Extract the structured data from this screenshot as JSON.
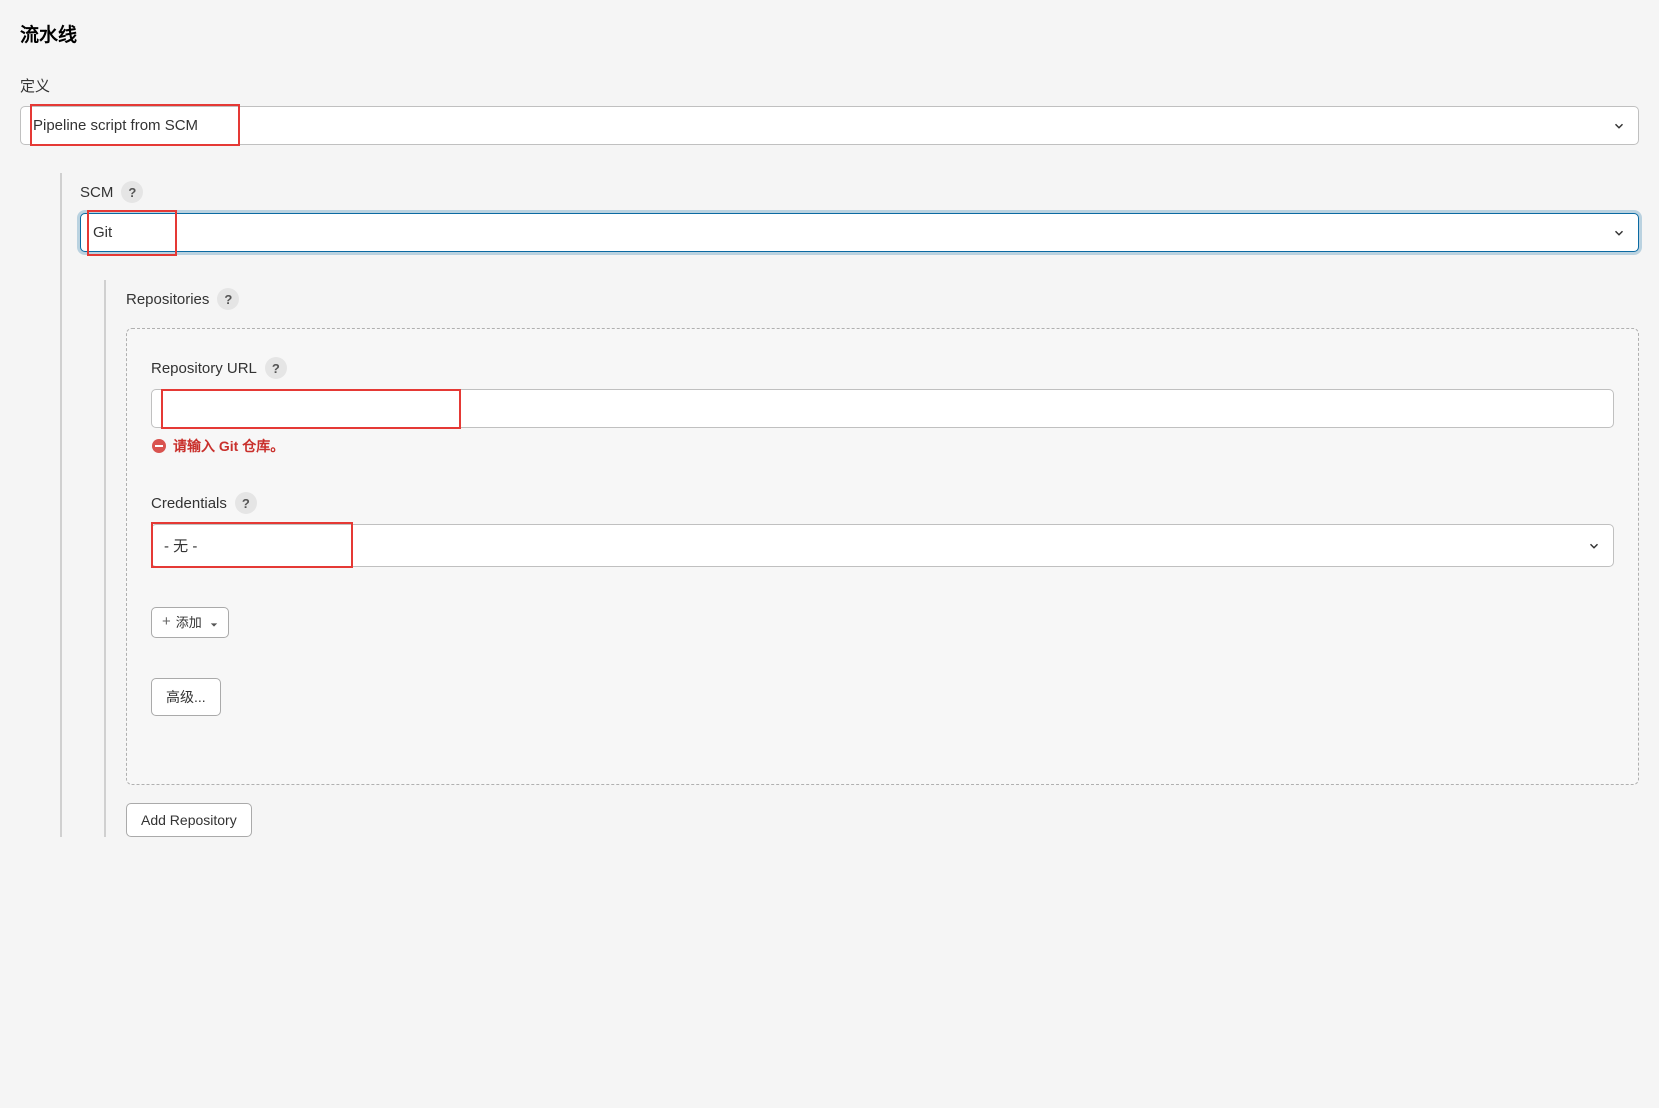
{
  "section": {
    "title": "流水线"
  },
  "definition": {
    "label": "定义",
    "selected": "Pipeline script from SCM"
  },
  "scm": {
    "label": "SCM",
    "selected": "Git"
  },
  "repositories": {
    "label": "Repositories",
    "repository_url": {
      "label": "Repository URL",
      "value": "",
      "error": "请输入 Git 仓库。"
    },
    "credentials": {
      "label": "Credentials",
      "selected": "- 无 -"
    },
    "add_button": "添加",
    "advanced_button": "高级...",
    "add_repository_button": "Add Repository"
  }
}
